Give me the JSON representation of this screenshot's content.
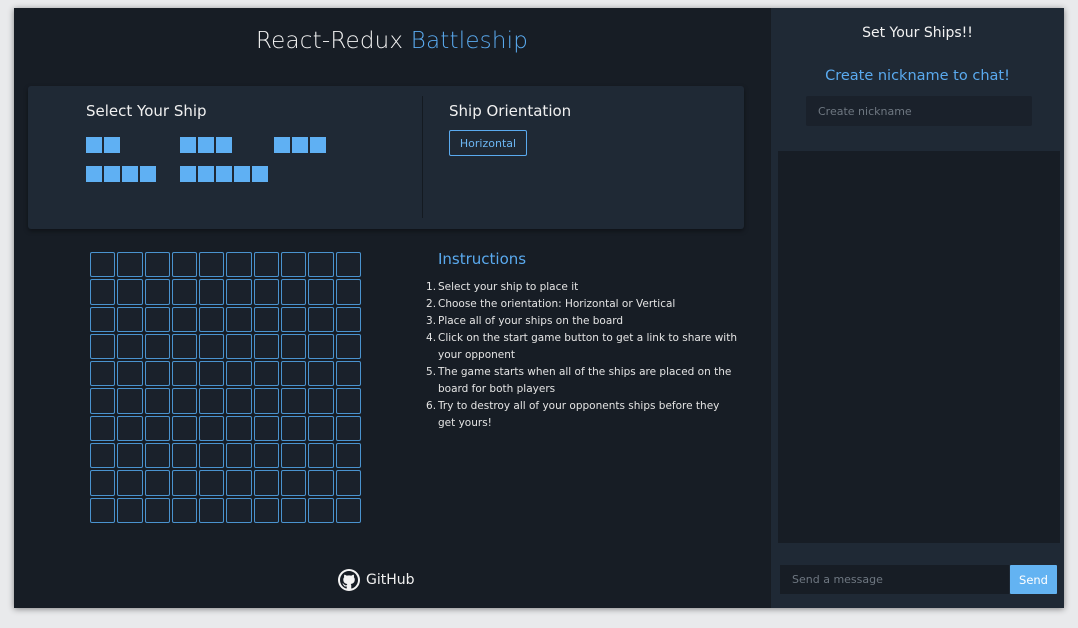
{
  "header": {
    "title_prefix": "React-Redux",
    "title_accent": "Battleship"
  },
  "ship_selection": {
    "heading": "Select Your Ship",
    "ships": [
      {
        "name": "ship-2",
        "size": 2
      },
      {
        "name": "ship-3a",
        "size": 3
      },
      {
        "name": "ship-3b",
        "size": 3
      },
      {
        "name": "ship-4",
        "size": 4
      },
      {
        "name": "ship-5",
        "size": 5
      }
    ]
  },
  "orientation": {
    "heading": "Ship Orientation",
    "button_label": "Horizontal"
  },
  "board": {
    "rows": 10,
    "cols": 10
  },
  "instructions": {
    "title": "Instructions",
    "steps": [
      "Select your ship to place it",
      "Choose the orientation: Horizontal or Vertical",
      "Place all of your ships on the board",
      "Click on the start game button to get a link to share with your opponent",
      "The game starts when all of the ships are placed on the board for both players",
      "Try to destroy all of your opponents ships before they get yours!"
    ]
  },
  "footer": {
    "github_label": "GitHub",
    "github_icon": "github-icon"
  },
  "sidebar": {
    "title": "Set Your Ships!!",
    "nickname_title": "Create nickname to chat!",
    "nickname_placeholder": "Create nickname",
    "nickname_value": "",
    "message_placeholder": "Send a message",
    "message_value": "",
    "send_label": "Send"
  },
  "colors": {
    "accent": "#5aaaef",
    "ship": "#5fb0f3",
    "background": "#171d25",
    "panel": "#1f2935"
  }
}
